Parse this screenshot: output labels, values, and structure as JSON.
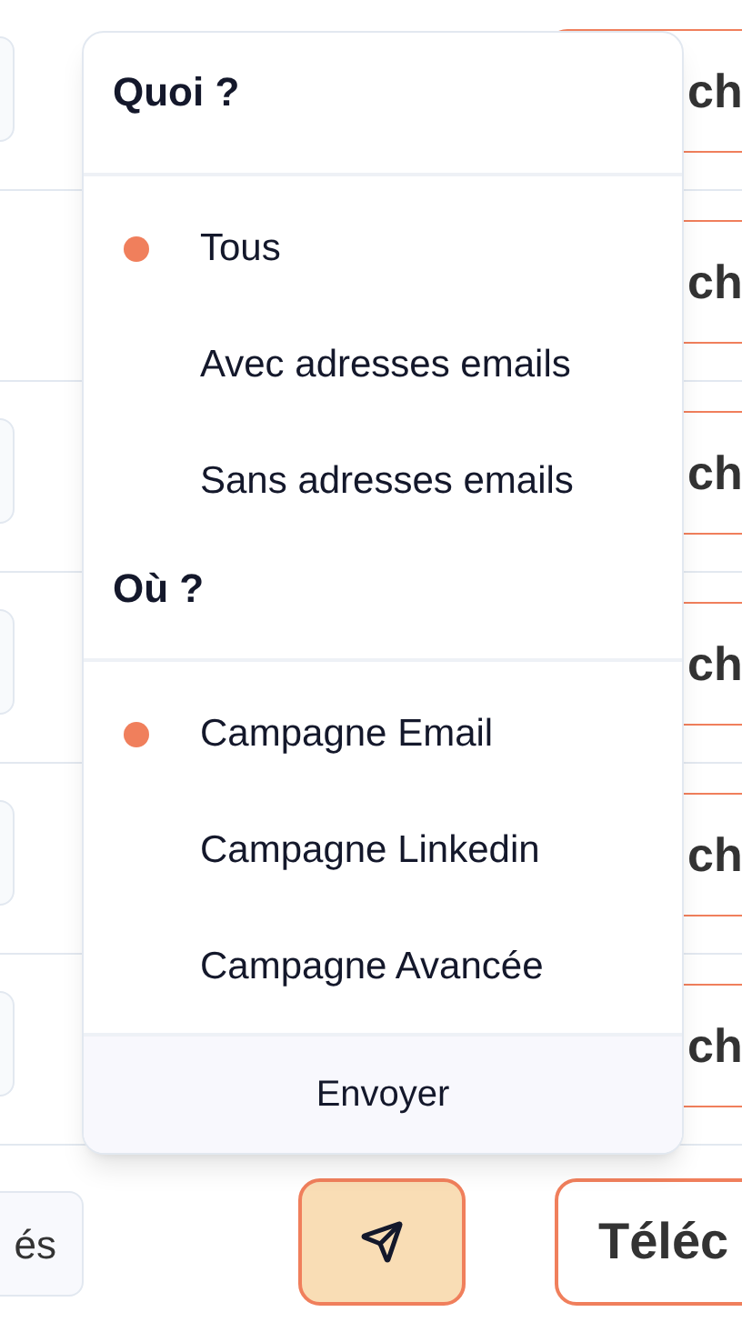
{
  "rows": [
    {
      "has_field": true,
      "action_label": "ch"
    },
    {
      "has_field": false,
      "action_label": "ch"
    },
    {
      "has_field": true,
      "action_label": "ch"
    },
    {
      "has_field": true,
      "action_label": "ch"
    },
    {
      "has_field": true,
      "action_label": "ch"
    },
    {
      "has_field": true,
      "action_label": "ch"
    }
  ],
  "footer": {
    "left_button": "és",
    "download_button": "Téléc"
  },
  "menu": {
    "sections": [
      {
        "title": "Quoi ?",
        "options": [
          {
            "label": "Tous",
            "selected": true
          },
          {
            "label": "Avec adresses emails",
            "selected": false
          },
          {
            "label": "Sans adresses emails",
            "selected": false
          }
        ]
      },
      {
        "title": "Où ?",
        "options": [
          {
            "label": "Campagne Email",
            "selected": true
          },
          {
            "label": "Campagne Linkedin",
            "selected": false
          },
          {
            "label": "Campagne Avancée",
            "selected": false
          }
        ]
      }
    ],
    "submit": "Envoyer"
  }
}
